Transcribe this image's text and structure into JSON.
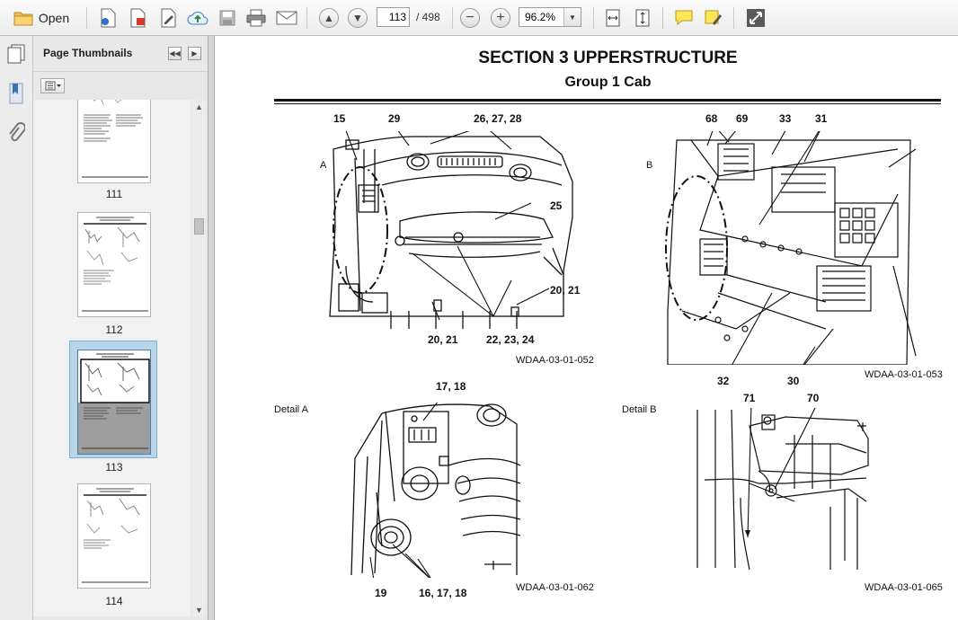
{
  "toolbar": {
    "open_label": "Open",
    "current_page": "113",
    "total_pages": "/ 498",
    "zoom": "96.2%"
  },
  "panel": {
    "title": "Page Thumbnails",
    "thumbnails": [
      {
        "label": "111"
      },
      {
        "label": "112"
      },
      {
        "label": "113",
        "selected": true
      },
      {
        "label": "114"
      }
    ]
  },
  "document": {
    "section_title": "SECTION 3 UPPERSTRUCTURE",
    "group_title": "Group 1 Cab",
    "figures": {
      "fig_a": {
        "view_letter": "A",
        "code": "WDAA-03-01-052",
        "callouts": [
          "15",
          "29",
          "26, 27, 28",
          "25",
          "20, 21",
          "20, 21",
          "22, 23, 24"
        ]
      },
      "fig_b": {
        "view_letter": "B",
        "code": "WDAA-03-01-053",
        "callouts": [
          "68",
          "69",
          "33",
          "31",
          "32",
          "30"
        ]
      },
      "detail_a": {
        "title": "Detail A",
        "code": "WDAA-03-01-062",
        "callouts": [
          "17, 18",
          "19",
          "16, 17, 18"
        ]
      },
      "detail_b": {
        "title": "Detail B",
        "code": "WDAA-03-01-065",
        "callouts": [
          "71",
          "70"
        ]
      }
    }
  },
  "colors": {
    "selection": "#b8d6ea",
    "toolbar_bg": "#f2f2f2",
    "page_bg": "#ffffff"
  }
}
